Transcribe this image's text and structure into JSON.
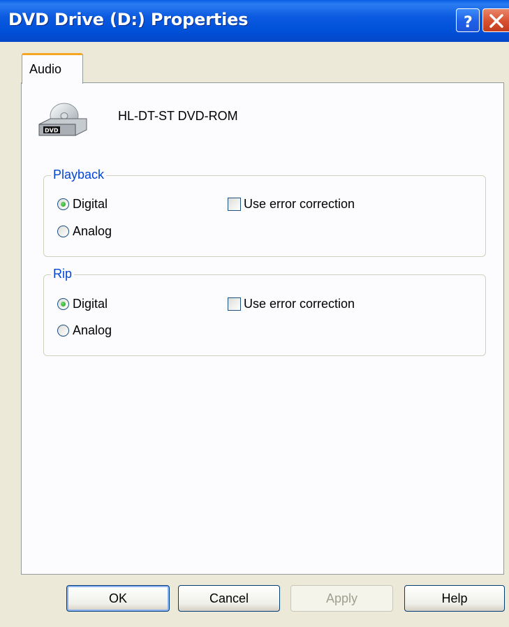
{
  "window": {
    "title": "DVD Drive (D:) Properties"
  },
  "titlebar_buttons": {
    "help_icon": "question-mark-icon",
    "close_icon": "close-x-icon"
  },
  "tabs": [
    {
      "label": "Audio",
      "selected": true
    }
  ],
  "device": {
    "name": "HL-DT-ST DVD-ROM",
    "icon": "dvd-drive-icon"
  },
  "playback": {
    "label": "Playback",
    "options": [
      {
        "label": "Digital",
        "selected": true
      },
      {
        "label": "Analog",
        "selected": false
      }
    ],
    "error_correction": {
      "label": "Use error correction",
      "checked": false
    }
  },
  "rip": {
    "label": "Rip",
    "options": [
      {
        "label": "Digital",
        "selected": true
      },
      {
        "label": "Analog",
        "selected": false
      }
    ],
    "error_correction": {
      "label": "Use error correction",
      "checked": false
    }
  },
  "buttons": {
    "ok": "OK",
    "cancel": "Cancel",
    "apply": "Apply",
    "help": "Help"
  },
  "colors": {
    "titlebar": "#0050d8",
    "group_label": "#0046d5",
    "dialog_bg": "#ece9d8",
    "tab_accent": "#f5a623"
  }
}
